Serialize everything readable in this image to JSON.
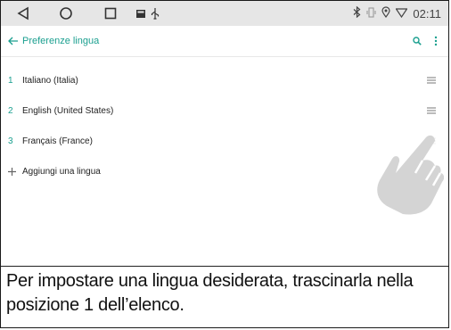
{
  "statusbar": {
    "nav_icons": [
      "back-triangle-icon",
      "home-circle-icon",
      "recents-square-icon"
    ],
    "notif_icons": [
      "image-icon",
      "usb-icon"
    ],
    "right_icons": [
      "bluetooth-icon",
      "vibrate-icon",
      "location-icon",
      "wifi-icon"
    ],
    "time": "02:11"
  },
  "appbar": {
    "title": "Preferenze lingua",
    "back_icon": "arrow-back-icon",
    "search_icon": "search-icon",
    "menu_icon": "more-vert-icon",
    "accent": "#1a9f8f"
  },
  "languages": [
    {
      "num": "1",
      "label": "Italiano (Italia)"
    },
    {
      "num": "2",
      "label": "English (United States)"
    },
    {
      "num": "3",
      "label": "Français (France)"
    }
  ],
  "add_language": {
    "label": "Aggiungi una lingua"
  },
  "caption": "Per impostare una lingua desiderata, trascinarla nella posizione 1 dell’elenco."
}
